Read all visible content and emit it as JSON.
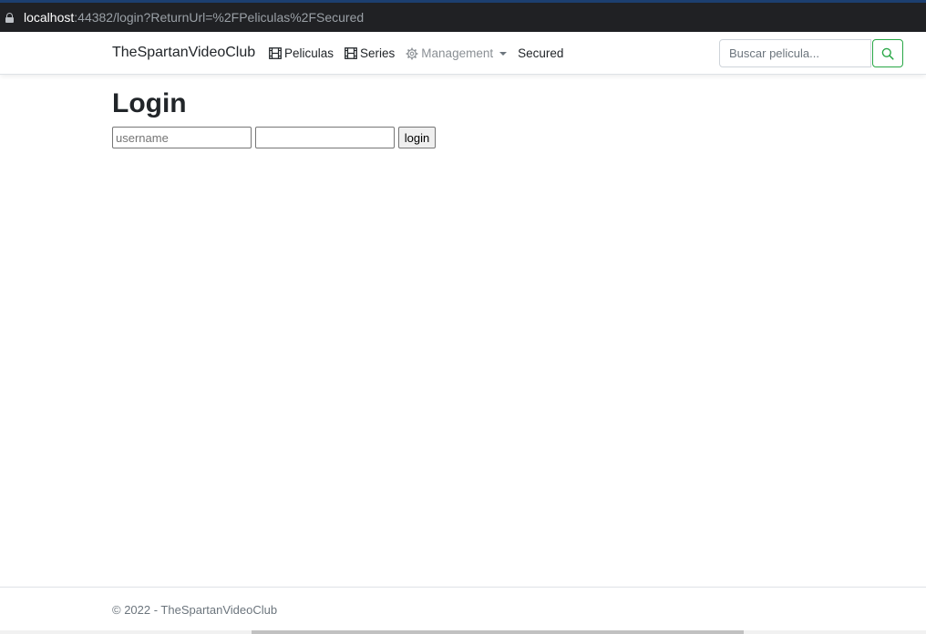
{
  "browser": {
    "url_host": "localhost",
    "url_rest": ":44382/login?ReturnUrl=%2FPeliculas%2FSecured"
  },
  "navbar": {
    "brand": "TheSpartanVideoClub",
    "items": [
      {
        "label": "Peliculas",
        "icon": "film-icon"
      },
      {
        "label": "Series",
        "icon": "film-icon"
      },
      {
        "label": "Management",
        "icon": "gear-icon"
      },
      {
        "label": "Secured"
      }
    ],
    "search": {
      "placeholder": "Buscar pelicula...",
      "value": ""
    },
    "search_button_icon": "search-icon",
    "search_button_color": "#28a745"
  },
  "main": {
    "title": "Login",
    "username_placeholder": "username",
    "username_value": "",
    "password_value": "",
    "login_button": "login"
  },
  "footer": {
    "text": "© 2022 - TheSpartanVideoClub"
  }
}
